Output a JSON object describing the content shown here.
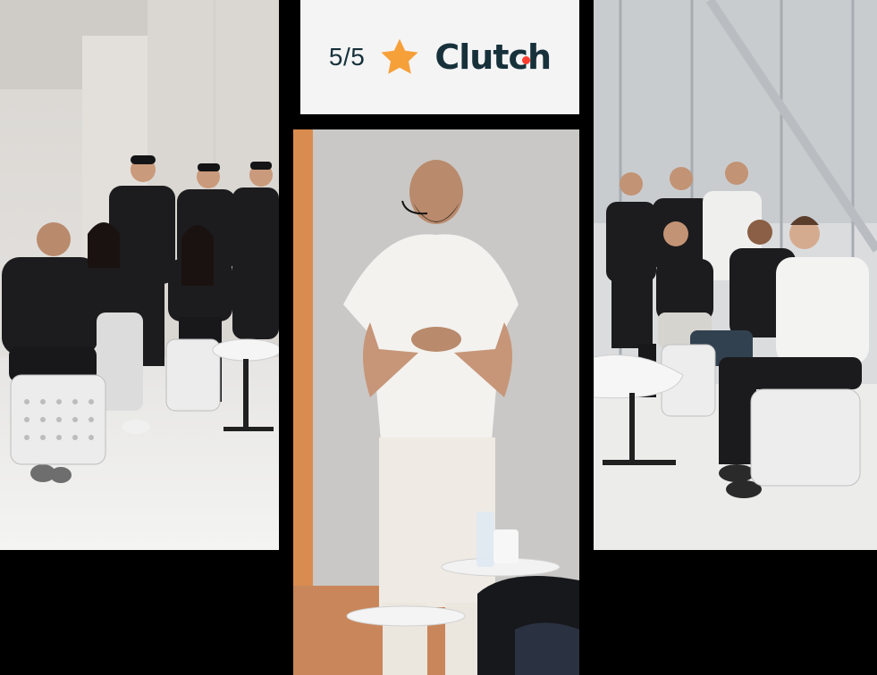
{
  "rating": {
    "score": "5/5",
    "icon": "star-icon",
    "brand": "Clutch",
    "star_color": "#f6a03a",
    "brand_color": "#17313b",
    "brand_accent": "#ff3d2e"
  },
  "photos": {
    "left": {
      "icon": "team-group-photo"
    },
    "center": {
      "icon": "speaker-photo"
    },
    "right": {
      "icon": "team-group-photo"
    }
  },
  "colors": {
    "background": "#000000",
    "card": "#f4f4f5"
  }
}
